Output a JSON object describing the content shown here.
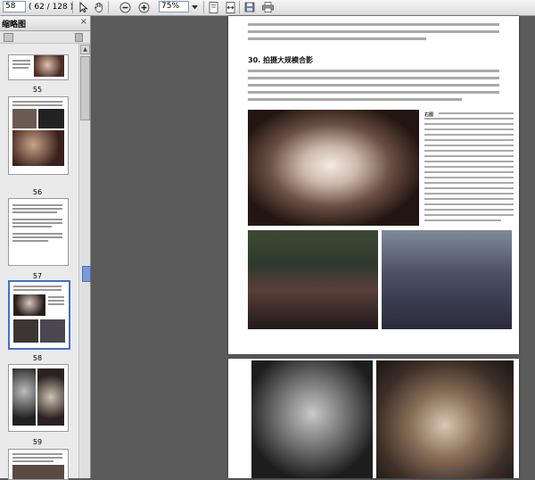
{
  "toolbar": {
    "page_number": "58",
    "page_count": "( 62 / 128 )",
    "zoom": "75%",
    "icons": [
      "select-tool-icon",
      "hand-tool-icon",
      "zoom-out-icon",
      "zoom-in-icon",
      "zoom-dropdown-icon",
      "fit-page-icon",
      "fit-width-icon",
      "save-icon",
      "print-icon"
    ]
  },
  "panel": {
    "title": "缩略图",
    "thumbnails": [
      {
        "label": "55"
      },
      {
        "label": "56"
      },
      {
        "label": "57"
      },
      {
        "label": "58"
      },
      {
        "label": "59"
      }
    ]
  },
  "document": {
    "section_title": "30. 拍摄大规模合影",
    "caption_label": "右图"
  }
}
